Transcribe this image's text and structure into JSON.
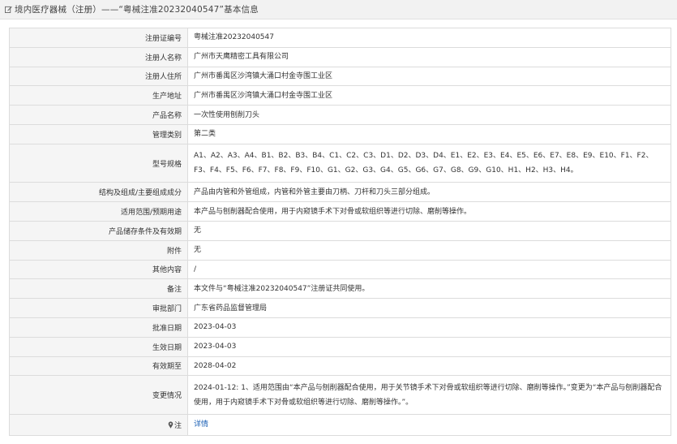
{
  "header": {
    "title": "境内医疗器械（注册）——“粤械注准20232040547”基本信息",
    "icon": "edit-icon"
  },
  "rows": [
    {
      "label": "注册证编号",
      "value": "粤械注准20232040547"
    },
    {
      "label": "注册人名称",
      "value": "广州市天鹰精密工具有限公司"
    },
    {
      "label": "注册人住所",
      "value": "广州市番禺区沙湾镇大涌口村金寺围工业区"
    },
    {
      "label": "生产地址",
      "value": "广州市番禺区沙湾镇大涌口村金寺围工业区"
    },
    {
      "label": "产品名称",
      "value": "一次性使用刨削刀头"
    },
    {
      "label": "管理类别",
      "value": "第二类"
    },
    {
      "label": "型号规格",
      "value": "A1、A2、A3、A4、B1、B2、B3、B4、C1、C2、C3、D1、D2、D3、D4、E1、E2、E3、E4、E5、E6、E7、E8、E9、E10、F1、F2、F3、F4、F5、F6、F7、F8、F9、F10、G1、G2、G3、G4、G5、G6、G7、G8、G9、G10、H1、H2、H3、H4。"
    },
    {
      "label": "结构及组成/主要组成成分",
      "value": "产品由内管和外管组成，内管和外管主要由刀柄、刀杆和刀头三部分组成。"
    },
    {
      "label": "适用范围/预期用途",
      "value": "本产品与刨削器配合使用，用于内窥镜手术下对骨或软组织等进行切除、磨削等操作。"
    },
    {
      "label": "产品储存条件及有效期",
      "value": "无"
    },
    {
      "label": "附件",
      "value": "无"
    },
    {
      "label": "其他内容",
      "value": "/"
    },
    {
      "label": "备注",
      "value": "本文件与“粤械注准20232040547”注册证共同使用。"
    },
    {
      "label": "审批部门",
      "value": "广东省药品监督管理局"
    },
    {
      "label": "批准日期",
      "value": "2023-04-03"
    },
    {
      "label": "生效日期",
      "value": "2023-04-03"
    },
    {
      "label": "有效期至",
      "value": "2028-04-02"
    },
    {
      "label": "变更情况",
      "value": "2024-01-12: 1、适用范围由“本产品与刨削器配合使用，用于关节镜手术下对骨或软组织等进行切除、磨削等操作。”变更为“本产品与刨削器配合使用，用于内窥镜手术下对骨或软组织等进行切除、磨削等操作。”。"
    }
  ],
  "note_row": {
    "label": "注",
    "link": "详情",
    "icon": "pin-icon"
  }
}
